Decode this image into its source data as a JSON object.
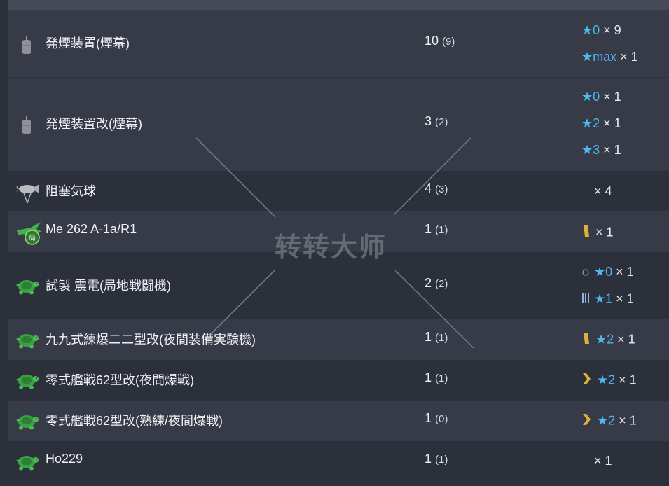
{
  "rows": [
    {
      "name": "発煙装置(煙幕)",
      "count": "10",
      "count_sub": "(9)",
      "icon": "smoke-generator-icon",
      "stars": [
        {
          "prof": "",
          "star": "★0",
          "mult": "× 9"
        },
        {
          "prof": "",
          "star": "★max",
          "mult": "× 1"
        }
      ]
    },
    {
      "name": "発煙装置改(煙幕)",
      "count": "3",
      "count_sub": "(2)",
      "icon": "smoke-generator-icon",
      "stars": [
        {
          "prof": "",
          "star": "★0",
          "mult": "× 1"
        },
        {
          "prof": "",
          "star": "★2",
          "mult": "× 1"
        },
        {
          "prof": "",
          "star": "★3",
          "mult": "× 1"
        }
      ]
    },
    {
      "name": "阻塞気球",
      "count": "4",
      "count_sub": "(3)",
      "icon": "barrage-balloon-icon",
      "stars": [
        {
          "prof": "",
          "star": "",
          "mult": "× 4"
        }
      ]
    },
    {
      "name": "Me 262 A-1a/R1",
      "count": "1",
      "count_sub": "(1)",
      "icon": "interceptor-plane-icon",
      "stars": [
        {
          "prof": "gold-single-bar",
          "star": "",
          "mult": "× 1"
        }
      ]
    },
    {
      "name": "試製 震電(局地戦闘機)",
      "count": "2",
      "count_sub": "(2)",
      "icon": "turtle-icon",
      "stars": [
        {
          "prof": "empty-circle",
          "star": "★0",
          "mult": "× 1"
        },
        {
          "prof": "blue-triple-bar",
          "star": "★1",
          "mult": "× 1"
        }
      ]
    },
    {
      "name": "九九式練爆二二型改(夜間装備実験機)",
      "count": "1",
      "count_sub": "(1)",
      "icon": "turtle-icon",
      "stars": [
        {
          "prof": "gold-single-bar",
          "star": "★2",
          "mult": "× 1"
        }
      ]
    },
    {
      "name": "零式艦戦62型改(夜間爆戦)",
      "count": "1",
      "count_sub": "(1)",
      "icon": "turtle-icon",
      "stars": [
        {
          "prof": "gold-chevron",
          "star": "★2",
          "mult": "× 1"
        }
      ]
    },
    {
      "name": "零式艦戦62型改(熟練/夜間爆戦)",
      "count": "1",
      "count_sub": "(0)",
      "icon": "turtle-icon",
      "stars": [
        {
          "prof": "gold-chevron",
          "star": "★2",
          "mult": "× 1"
        }
      ]
    },
    {
      "name": "Ho229",
      "count": "1",
      "count_sub": "(1)",
      "icon": "turtle-icon",
      "stars": [
        {
          "prof": "",
          "star": "",
          "mult": "× 1"
        }
      ]
    }
  ],
  "watermark": "转转大师",
  "colors": {
    "star": "#4db8f2",
    "row_alt": "#363b47",
    "row": "#2b303a",
    "gold": "#d9b23a",
    "turtle_green": "#3aa043"
  }
}
